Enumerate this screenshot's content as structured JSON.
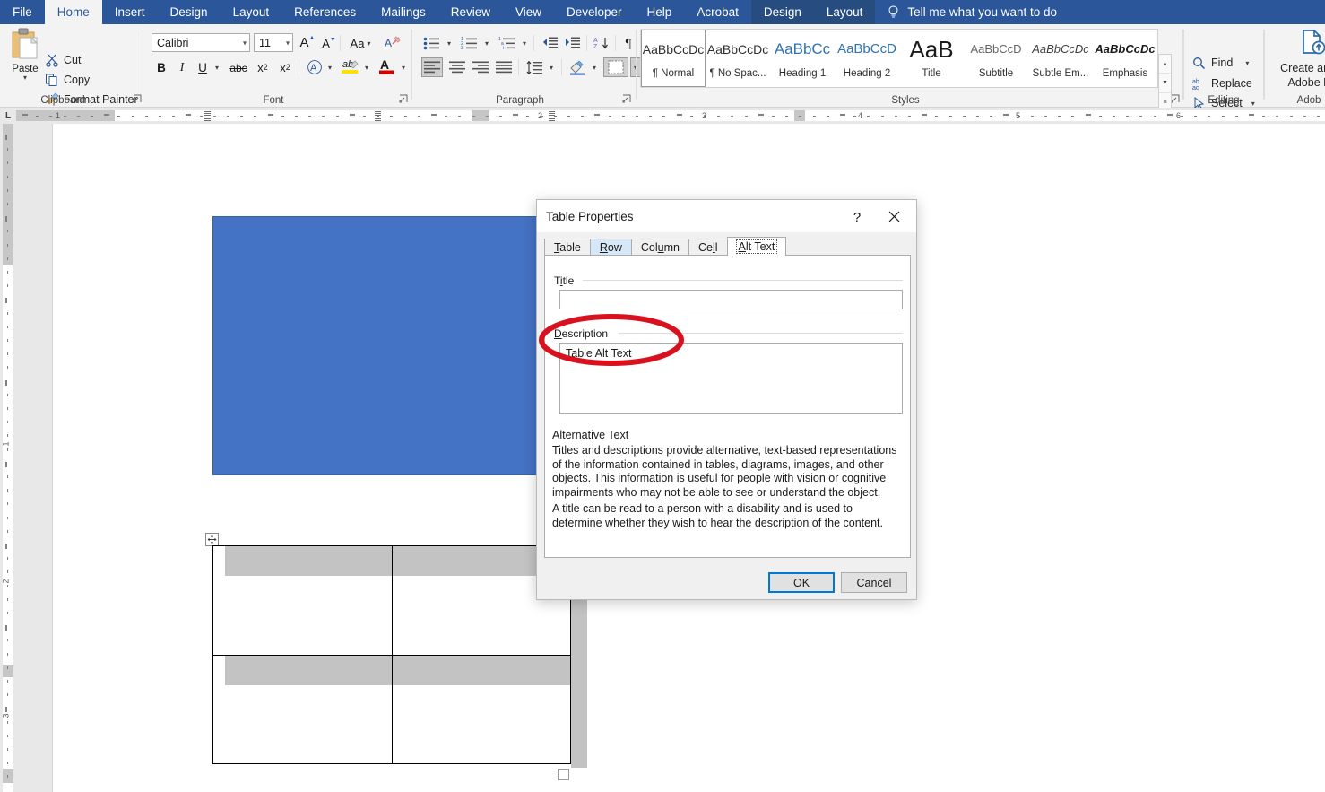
{
  "app": {
    "name": "Microsoft Word",
    "accent": "#2B579A",
    "contextual_tab_bg": "#274D80"
  },
  "ribbon": {
    "tabs": [
      {
        "label": "File",
        "state": "normal"
      },
      {
        "label": "Home",
        "state": "active"
      },
      {
        "label": "Insert",
        "state": "normal"
      },
      {
        "label": "Design",
        "state": "normal"
      },
      {
        "label": "Layout",
        "state": "normal"
      },
      {
        "label": "References",
        "state": "normal"
      },
      {
        "label": "Mailings",
        "state": "normal"
      },
      {
        "label": "Review",
        "state": "normal"
      },
      {
        "label": "View",
        "state": "normal"
      },
      {
        "label": "Developer",
        "state": "normal"
      },
      {
        "label": "Help",
        "state": "normal"
      },
      {
        "label": "Acrobat",
        "state": "normal"
      },
      {
        "label": "Design",
        "state": "contextual"
      },
      {
        "label": "Layout",
        "state": "contextual"
      }
    ],
    "tell_me": {
      "label": "Tell me what you want to do",
      "icon": "lightbulb-icon"
    },
    "groups": {
      "clipboard": {
        "label": "Clipboard",
        "paste": "Paste",
        "items": [
          {
            "label": "Cut",
            "icon": "scissors-icon"
          },
          {
            "label": "Copy",
            "icon": "copy-icon"
          },
          {
            "label": "Format Painter",
            "icon": "paintbrush-icon"
          }
        ]
      },
      "font": {
        "label": "Font",
        "font_name": "Calibri",
        "font_size": "11",
        "buttons": [
          {
            "name": "grow-font",
            "glyph": "A"
          },
          {
            "name": "shrink-font",
            "glyph": "A"
          },
          {
            "name": "change-case",
            "glyph": "Aa"
          },
          {
            "name": "clear-formatting",
            "glyph": "A"
          },
          {
            "name": "bold",
            "glyph": "B"
          },
          {
            "name": "italic",
            "glyph": "I"
          },
          {
            "name": "underline",
            "glyph": "U"
          },
          {
            "name": "strikethrough",
            "glyph": "abc"
          },
          {
            "name": "subscript",
            "glyph": "x₂"
          },
          {
            "name": "superscript",
            "glyph": "x²"
          },
          {
            "name": "text-effects",
            "glyph": "A"
          },
          {
            "name": "text-highlight-color",
            "glyph": "ab"
          },
          {
            "name": "font-color",
            "glyph": "A"
          }
        ]
      },
      "paragraph": {
        "label": "Paragraph",
        "buttons": [
          {
            "name": "bullets"
          },
          {
            "name": "numbering"
          },
          {
            "name": "multilevel-list"
          },
          {
            "name": "decrease-indent"
          },
          {
            "name": "increase-indent"
          },
          {
            "name": "sort"
          },
          {
            "name": "show-formatting-marks"
          },
          {
            "name": "align-left"
          },
          {
            "name": "align-center"
          },
          {
            "name": "align-right"
          },
          {
            "name": "justify"
          },
          {
            "name": "line-spacing"
          },
          {
            "name": "shading"
          },
          {
            "name": "borders"
          }
        ]
      },
      "styles": {
        "label": "Styles",
        "items": [
          {
            "preview": "AaBbCcDc",
            "name": "¶ Normal",
            "selected": true,
            "color": "#303030",
            "size": "14px"
          },
          {
            "preview": "AaBbCcDc",
            "name": "¶ No Spac...",
            "selected": false,
            "color": "#303030",
            "size": "14px"
          },
          {
            "preview": "AaBbCс",
            "name": "Heading 1",
            "selected": false,
            "color": "#2E74B5",
            "size": "17px"
          },
          {
            "preview": "AaBbCcD",
            "name": "Heading 2",
            "selected": false,
            "color": "#2E74B5",
            "size": "15px"
          },
          {
            "preview": "AaB",
            "name": "Title",
            "selected": false,
            "color": "#1a1a1a",
            "size": "26px"
          },
          {
            "preview": "AaBbCcD",
            "name": "Subtitle",
            "selected": false,
            "color": "#666666",
            "size": "13px"
          },
          {
            "preview": "AaBbCcDc",
            "name": "Subtle Em...",
            "selected": false,
            "color": "#404040",
            "size": "13px"
          },
          {
            "preview": "AaBbCcDc",
            "name": "Emphasis",
            "selected": false,
            "color": "#1a1a1a",
            "size": "13px"
          }
        ]
      },
      "editing": {
        "label": "Editing",
        "items": [
          {
            "label": "Find",
            "icon": "magnifier-icon",
            "has_caret": true
          },
          {
            "label": "Replace",
            "icon": "replace-abac-icon",
            "has_caret": false
          },
          {
            "label": "Select",
            "icon": "cursor-arrow-icon",
            "has_caret": true
          }
        ]
      },
      "adobe": {
        "label": "Adob",
        "button_line1": "Create and S",
        "button_line2": "Adobe PD",
        "icon": "create-pdf-icon"
      }
    }
  },
  "ruler": {
    "corner_glyph": "L",
    "horizontal_numbers": [
      "1",
      "2",
      "3",
      "4",
      "5",
      "6"
    ],
    "vertical_numbers": [
      "1",
      "2",
      "3"
    ]
  },
  "document": {
    "blue_shape": {
      "name": "blue-rectangle",
      "fill": "#4472C4",
      "border": "#39639F"
    },
    "table": {
      "rows": 2,
      "columns": 2,
      "header_band_color": "#C3C3C3",
      "border_color": "#000000",
      "move_handle": "table-move-handle",
      "resize_handle": "table-resize-handle"
    }
  },
  "dialog": {
    "title": "Table Properties",
    "help_glyph": "?",
    "close_glyph": "✕",
    "tabs": [
      {
        "label": "Table",
        "accel": "T",
        "state": "normal"
      },
      {
        "label": "Row",
        "accel": "R",
        "state": "highlight"
      },
      {
        "label": "Column",
        "accel": "u",
        "state": "normal"
      },
      {
        "label": "Cell",
        "accel": "l",
        "state": "normal"
      },
      {
        "label": "Alt Text",
        "accel": "A",
        "state": "selected"
      }
    ],
    "title_group": {
      "label": "Title",
      "value": "",
      "placeholder": ""
    },
    "description_group": {
      "label": "Description",
      "value": "Table Alt Text",
      "placeholder": ""
    },
    "alt_text_heading": "Alternative Text",
    "alt_text_para1": "Titles and descriptions provide alternative, text-based representations of the information contained in tables, diagrams, images, and other objects. This information is useful for people with vision or cognitive impairments who may not be able to see or understand the object.",
    "alt_text_para2": "A title can be read to a person with a disability and is used to determine whether they wish to hear the description of the content.",
    "buttons": {
      "ok": "OK",
      "cancel": "Cancel"
    }
  },
  "annotation": {
    "name": "red-ellipse-highlight",
    "color": "#D9111F",
    "target": "Table Alt Text"
  }
}
